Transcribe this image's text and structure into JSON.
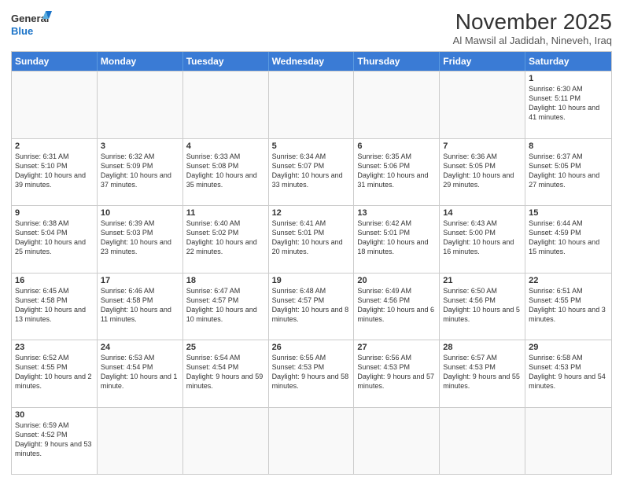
{
  "logo": {
    "general": "General",
    "blue": "Blue"
  },
  "title": "November 2025",
  "location": "Al Mawsil al Jadidah, Nineveh, Iraq",
  "days_of_week": [
    "Sunday",
    "Monday",
    "Tuesday",
    "Wednesday",
    "Thursday",
    "Friday",
    "Saturday"
  ],
  "weeks": [
    [
      {
        "day": "",
        "text": ""
      },
      {
        "day": "",
        "text": ""
      },
      {
        "day": "",
        "text": ""
      },
      {
        "day": "",
        "text": ""
      },
      {
        "day": "",
        "text": ""
      },
      {
        "day": "",
        "text": ""
      },
      {
        "day": "1",
        "text": "Sunrise: 6:30 AM\nSunset: 5:11 PM\nDaylight: 10 hours and 41 minutes."
      }
    ],
    [
      {
        "day": "2",
        "text": "Sunrise: 6:31 AM\nSunset: 5:10 PM\nDaylight: 10 hours and 39 minutes."
      },
      {
        "day": "3",
        "text": "Sunrise: 6:32 AM\nSunset: 5:09 PM\nDaylight: 10 hours and 37 minutes."
      },
      {
        "day": "4",
        "text": "Sunrise: 6:33 AM\nSunset: 5:08 PM\nDaylight: 10 hours and 35 minutes."
      },
      {
        "day": "5",
        "text": "Sunrise: 6:34 AM\nSunset: 5:07 PM\nDaylight: 10 hours and 33 minutes."
      },
      {
        "day": "6",
        "text": "Sunrise: 6:35 AM\nSunset: 5:06 PM\nDaylight: 10 hours and 31 minutes."
      },
      {
        "day": "7",
        "text": "Sunrise: 6:36 AM\nSunset: 5:05 PM\nDaylight: 10 hours and 29 minutes."
      },
      {
        "day": "8",
        "text": "Sunrise: 6:37 AM\nSunset: 5:05 PM\nDaylight: 10 hours and 27 minutes."
      }
    ],
    [
      {
        "day": "9",
        "text": "Sunrise: 6:38 AM\nSunset: 5:04 PM\nDaylight: 10 hours and 25 minutes."
      },
      {
        "day": "10",
        "text": "Sunrise: 6:39 AM\nSunset: 5:03 PM\nDaylight: 10 hours and 23 minutes."
      },
      {
        "day": "11",
        "text": "Sunrise: 6:40 AM\nSunset: 5:02 PM\nDaylight: 10 hours and 22 minutes."
      },
      {
        "day": "12",
        "text": "Sunrise: 6:41 AM\nSunset: 5:01 PM\nDaylight: 10 hours and 20 minutes."
      },
      {
        "day": "13",
        "text": "Sunrise: 6:42 AM\nSunset: 5:01 PM\nDaylight: 10 hours and 18 minutes."
      },
      {
        "day": "14",
        "text": "Sunrise: 6:43 AM\nSunset: 5:00 PM\nDaylight: 10 hours and 16 minutes."
      },
      {
        "day": "15",
        "text": "Sunrise: 6:44 AM\nSunset: 4:59 PM\nDaylight: 10 hours and 15 minutes."
      }
    ],
    [
      {
        "day": "16",
        "text": "Sunrise: 6:45 AM\nSunset: 4:58 PM\nDaylight: 10 hours and 13 minutes."
      },
      {
        "day": "17",
        "text": "Sunrise: 6:46 AM\nSunset: 4:58 PM\nDaylight: 10 hours and 11 minutes."
      },
      {
        "day": "18",
        "text": "Sunrise: 6:47 AM\nSunset: 4:57 PM\nDaylight: 10 hours and 10 minutes."
      },
      {
        "day": "19",
        "text": "Sunrise: 6:48 AM\nSunset: 4:57 PM\nDaylight: 10 hours and 8 minutes."
      },
      {
        "day": "20",
        "text": "Sunrise: 6:49 AM\nSunset: 4:56 PM\nDaylight: 10 hours and 6 minutes."
      },
      {
        "day": "21",
        "text": "Sunrise: 6:50 AM\nSunset: 4:56 PM\nDaylight: 10 hours and 5 minutes."
      },
      {
        "day": "22",
        "text": "Sunrise: 6:51 AM\nSunset: 4:55 PM\nDaylight: 10 hours and 3 minutes."
      }
    ],
    [
      {
        "day": "23",
        "text": "Sunrise: 6:52 AM\nSunset: 4:55 PM\nDaylight: 10 hours and 2 minutes."
      },
      {
        "day": "24",
        "text": "Sunrise: 6:53 AM\nSunset: 4:54 PM\nDaylight: 10 hours and 1 minute."
      },
      {
        "day": "25",
        "text": "Sunrise: 6:54 AM\nSunset: 4:54 PM\nDaylight: 9 hours and 59 minutes."
      },
      {
        "day": "26",
        "text": "Sunrise: 6:55 AM\nSunset: 4:53 PM\nDaylight: 9 hours and 58 minutes."
      },
      {
        "day": "27",
        "text": "Sunrise: 6:56 AM\nSunset: 4:53 PM\nDaylight: 9 hours and 57 minutes."
      },
      {
        "day": "28",
        "text": "Sunrise: 6:57 AM\nSunset: 4:53 PM\nDaylight: 9 hours and 55 minutes."
      },
      {
        "day": "29",
        "text": "Sunrise: 6:58 AM\nSunset: 4:53 PM\nDaylight: 9 hours and 54 minutes."
      }
    ],
    [
      {
        "day": "30",
        "text": "Sunrise: 6:59 AM\nSunset: 4:52 PM\nDaylight: 9 hours and 53 minutes."
      },
      {
        "day": "",
        "text": ""
      },
      {
        "day": "",
        "text": ""
      },
      {
        "day": "",
        "text": ""
      },
      {
        "day": "",
        "text": ""
      },
      {
        "day": "",
        "text": ""
      },
      {
        "day": "",
        "text": ""
      }
    ]
  ]
}
